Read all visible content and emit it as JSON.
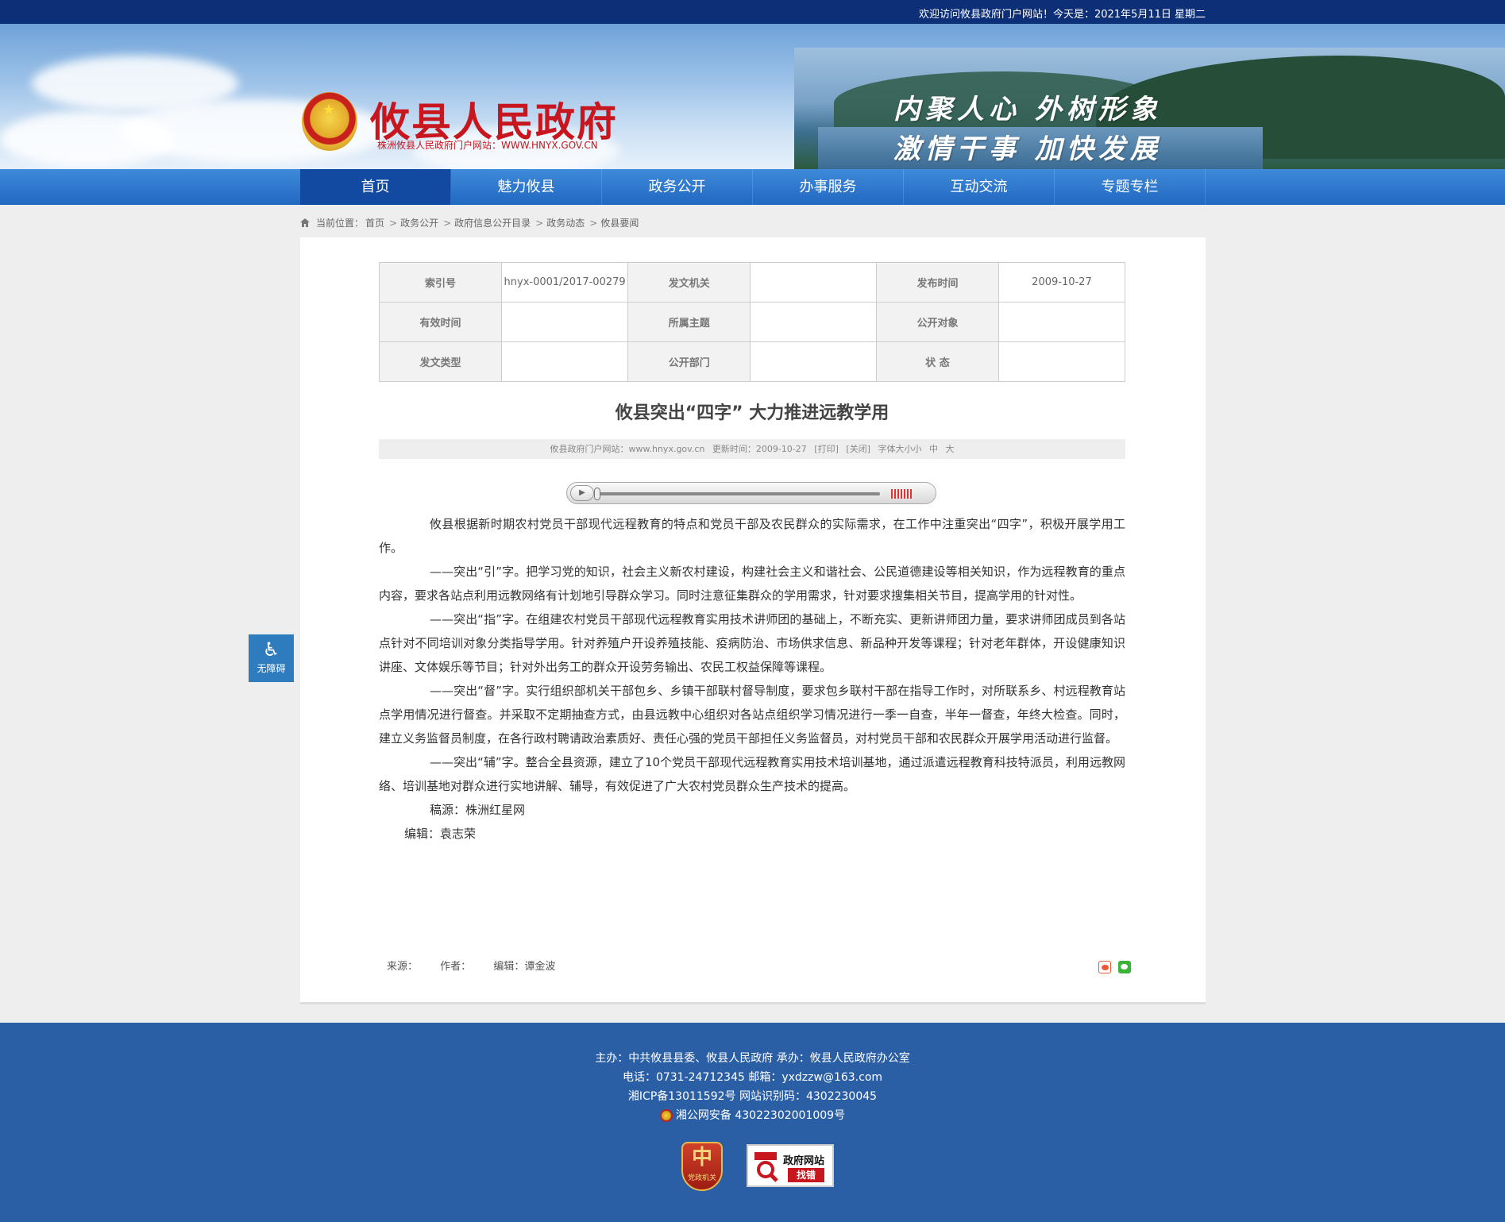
{
  "topbar": {
    "welcome": "欢迎访问攸县政府门户网站！今天是：2021年5月11日 星期二"
  },
  "header": {
    "site_title": "攸县人民政府",
    "site_subtitle": "株洲攸县人民政府门户网站：WWW.HNYX.GOV.CN",
    "slogan_line1": "内聚人心 外树形象",
    "slogan_line2": "激情干事 加快发展"
  },
  "nav": {
    "items": [
      "首页",
      "魅力攸县",
      "政务公开",
      "办事服务",
      "互动交流",
      "专题专栏"
    ],
    "active": "首页"
  },
  "breadcrumb": {
    "prefix": "当前位置：",
    "items": [
      "首页",
      "政务公开",
      "政府信息公开目录",
      "政务动态",
      "攸县要闻"
    ]
  },
  "meta_table": {
    "rows": [
      [
        {
          "label": "索引号",
          "value": "hnyx-0001/2017-00279"
        },
        {
          "label": "发文机关",
          "value": ""
        },
        {
          "label": "发布时间",
          "value": "2009-10-27"
        }
      ],
      [
        {
          "label": "有效时间",
          "value": ""
        },
        {
          "label": "所属主题",
          "value": ""
        },
        {
          "label": "公开对象",
          "value": ""
        }
      ],
      [
        {
          "label": "发文类型",
          "value": ""
        },
        {
          "label": "公开部门",
          "value": ""
        },
        {
          "label": "状 态",
          "value": ""
        }
      ]
    ]
  },
  "article": {
    "title": "攸县突出“四字” 大力推进远教学用",
    "info": {
      "source_site": "攸县政府门户网站：www.hnyx.gov.cn",
      "update_time": "更新时间：2009-10-27",
      "print": "[打印]",
      "close": "[关闭]",
      "font_size": "字体大小",
      "font_small": "小",
      "font_medium": "中",
      "font_large": "大"
    },
    "paragraphs": [
      "攸县根据新时期农村党员干部现代远程教育的特点和党员干部及农民群众的实际需求，在工作中注重突出“四字”，积极开展学用工作。",
      "——突出“引”字。把学习党的知识，社会主义新农村建设，构建社会主义和谐社会、公民道德建设等相关知识，作为远程教育的重点内容，要求各站点利用远教网络有计划地引导群众学习。同时注意征集群众的学用需求，针对要求搜集相关节目，提高学用的针对性。",
      "——突出“指”字。在组建农村党员干部现代远程教育实用技术讲师团的基础上，不断充实、更新讲师团力量，要求讲师团成员到各站点针对不同培训对象分类指导学用。针对养殖户开设养殖技能、疫病防治、市场供求信息、新品种开发等课程；针对老年群体，开设健康知识讲座、文体娱乐等节目；针对外出务工的群众开设劳务输出、农民工权益保障等课程。",
      "——突出“督”字。实行组织部机关干部包乡、乡镇干部联村督导制度，要求包乡联村干部在指导工作时，对所联系乡、村远程教育站点学用情况进行督查。并采取不定期抽查方式，由县远教中心组织对各站点组织学习情况进行一季一自查，半年一督查，年终大检查。同时，建立义务监督员制度，在各行政村聘请政治素质好、责任心强的党员干部担任义务监督员，对村党员干部和农民群众开展学用活动进行监督。",
      "——突出“辅”字。整合全县资源，建立了10个党员干部现代远程教育实用技术培训基地，通过派遣远程教育科技特派员，利用远教网络、培训基地对群众进行实地讲解、辅导，有效促进了广大农村党员群众生产技术的提高。",
      "稿源：株洲红星网"
    ],
    "editor_line": "编辑：袁志荣"
  },
  "article_footer": {
    "source": "来源：",
    "author": "作者：",
    "editor": "编辑：谭金波"
  },
  "accessibility": {
    "label": "无障碍"
  },
  "footer": {
    "line1": "主办：中共攸县县委、攸县人民政府 承办：攸县人民政府办公室",
    "line2": "电话：0731-24712345 邮箱：yxdzzw@163.com",
    "line3": "湘ICP备13011592号 网站识别码：4302230045",
    "line4": "湘公网安备 43022302001009号",
    "badge_party_char": "中",
    "badge_party_label": "党政机关",
    "badge_gov_title": "政府网站",
    "badge_gov_action": "找错"
  },
  "colors": {
    "nav_blue": "#2168c2",
    "nav_active": "#114aa0",
    "topbar": "#0d2f78",
    "footer": "#2a5fa6",
    "title_red": "#c8161e"
  }
}
